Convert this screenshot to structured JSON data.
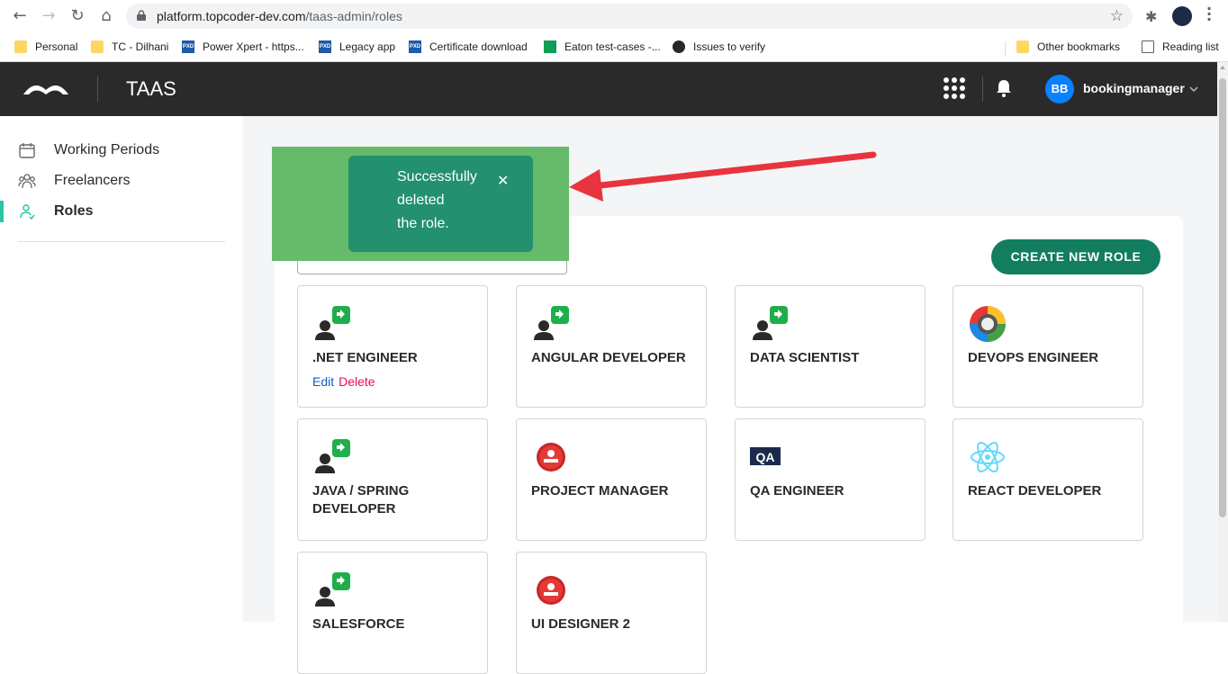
{
  "browser": {
    "url_host": "platform.topcoder-dev.com",
    "url_path": "/taas-admin/roles",
    "bookmarks": [
      {
        "label": "Personal",
        "icon": "folder-icon"
      },
      {
        "label": "TC - Dilhani",
        "icon": "folder-icon"
      },
      {
        "label": "Power Xpert - https...",
        "icon": "pxd-icon"
      },
      {
        "label": "Legacy app",
        "icon": "pxd-icon"
      },
      {
        "label": "Certificate download",
        "icon": "pxd-icon"
      },
      {
        "label": "Eaton test-cases -...",
        "icon": "sheets-icon"
      },
      {
        "label": "Issues to verify",
        "icon": "github-icon"
      }
    ],
    "other_bookmarks": "Other bookmarks",
    "reading_list": "Reading list"
  },
  "header": {
    "app_title": "TAAS",
    "avatar_initials": "BB",
    "username": "bookingmanager"
  },
  "sidebar": {
    "items": [
      {
        "label": "Working Periods",
        "icon": "calendar-icon",
        "active": false
      },
      {
        "label": "Freelancers",
        "icon": "people-icon",
        "active": false
      },
      {
        "label": "Roles",
        "icon": "person-icon",
        "active": true
      }
    ]
  },
  "toast": {
    "message": "Successfully\ndeleted\nthe role.",
    "close": "✕"
  },
  "main": {
    "create_button": "CREATE NEW ROLE",
    "edit_label": "Edit",
    "delete_label": "Delete",
    "roles": [
      {
        "name": ".NET ENGINEER",
        "icon": "developer-icon",
        "hovered": true
      },
      {
        "name": "ANGULAR DEVELOPER",
        "icon": "developer-icon"
      },
      {
        "name": "DATA SCIENTIST",
        "icon": "developer-icon"
      },
      {
        "name": "DEVOPS ENGINEER",
        "icon": "devops-icon"
      },
      {
        "name": "JAVA / SPRING DEVELOPER",
        "icon": "developer-icon"
      },
      {
        "name": "PROJECT MANAGER",
        "icon": "red-person-icon"
      },
      {
        "name": "QA ENGINEER",
        "icon": "qa-icon"
      },
      {
        "name": "REACT DEVELOPER",
        "icon": "react-icon"
      },
      {
        "name": "SALESFORCE",
        "icon": "developer-icon"
      },
      {
        "name": "UI DESIGNER 2",
        "icon": "red-person-icon"
      }
    ]
  },
  "colors": {
    "header_bg": "#2a2a2a",
    "primary_button": "#137d60",
    "toast_outer": "#66bb6a",
    "toast_inner": "#23906f",
    "active_accent": "#2cc5a4",
    "delete_link": "#e90c5a",
    "edit_link": "#0d61bf",
    "arrow": "#e8343e"
  }
}
